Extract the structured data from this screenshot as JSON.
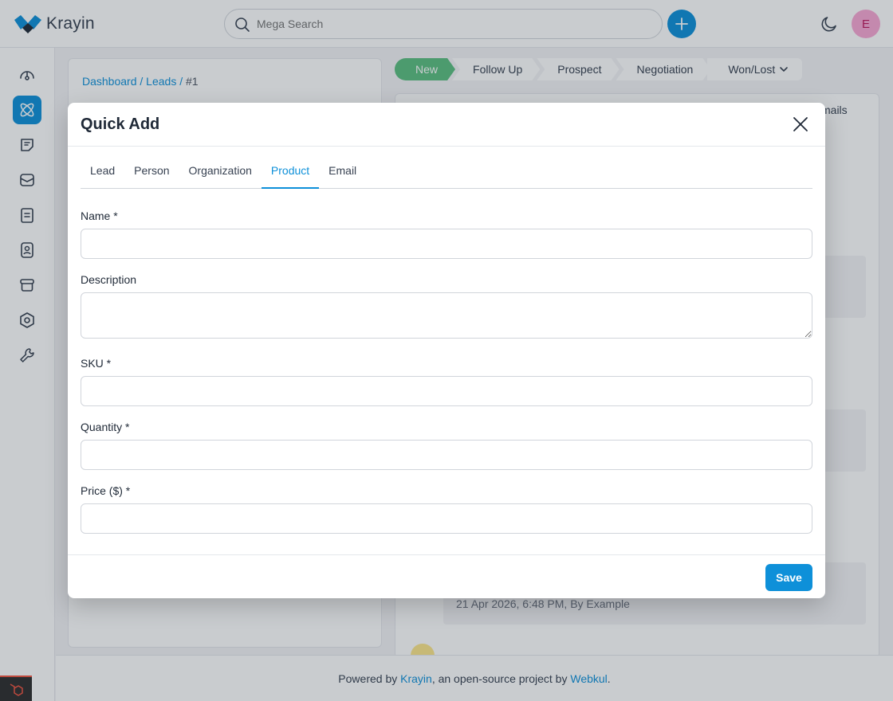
{
  "app": {
    "name": "Krayin",
    "brand_color": "#0e90d9"
  },
  "header": {
    "search_placeholder": "Mega Search",
    "avatar_initial": "E"
  },
  "sidebar": {
    "items": [
      {
        "icon": "dashboard-icon",
        "active": false
      },
      {
        "icon": "leads-icon",
        "active": true
      },
      {
        "icon": "quotes-icon",
        "active": false
      },
      {
        "icon": "mail-icon",
        "active": false
      },
      {
        "icon": "activities-icon",
        "active": false
      },
      {
        "icon": "contacts-icon",
        "active": false
      },
      {
        "icon": "products-icon",
        "active": false
      },
      {
        "icon": "settings-icon",
        "active": false
      },
      {
        "icon": "configuration-icon",
        "active": false
      }
    ]
  },
  "breadcrumb": {
    "dashboard": "Dashboard",
    "leads": "Leads",
    "sep": "/",
    "current": "#1"
  },
  "stages": [
    "New",
    "Follow Up",
    "Prospect",
    "Negotiation",
    "Won/Lost"
  ],
  "background": {
    "tab_emails": "mails",
    "activity_time": "21 Apr 2026, 6:48 PM, By Example"
  },
  "footer": {
    "prefix": "Powered by",
    "link1": "Krayin",
    "middle": ", an open-source project by",
    "link2": "Webkul",
    "suffix": "."
  },
  "modal": {
    "title": "Quick Add",
    "tabs": [
      "Lead",
      "Person",
      "Organization",
      "Product",
      "Email"
    ],
    "active_tab": "Product",
    "fields": {
      "name_label": "Name *",
      "name_value": "",
      "description_label": "Description",
      "description_value": "",
      "sku_label": "SKU *",
      "sku_value": "",
      "quantity_label": "Quantity *",
      "quantity_value": "",
      "price_label": "Price ($) *",
      "price_value": ""
    },
    "save_label": "Save"
  }
}
